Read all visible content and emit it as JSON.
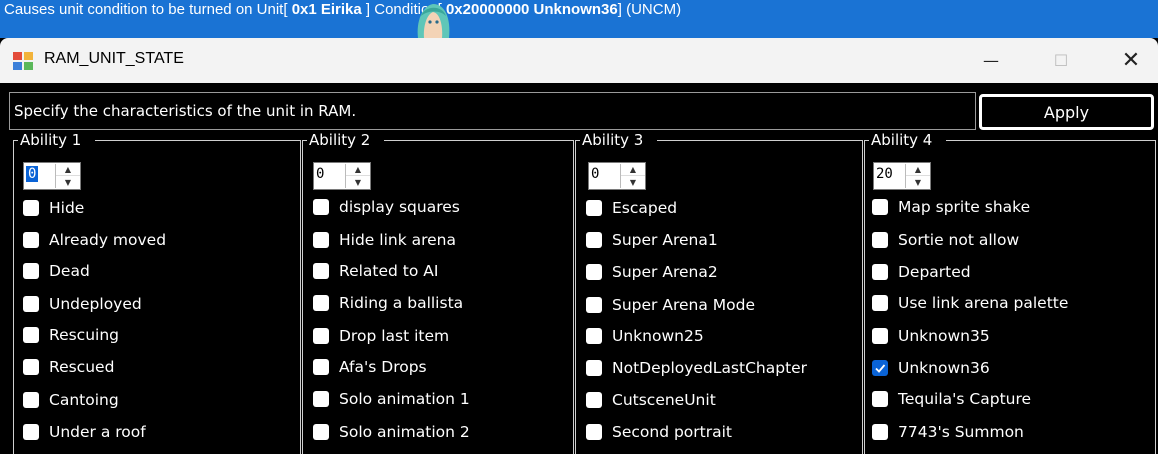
{
  "banner": {
    "prefix": "Causes unit condition to be turned on  Unit[ ",
    "unit_value": "0x1 Eirika",
    "middle": " ] Condition[ ",
    "condition_value": "0x20000000 Unknown36",
    "suffix": "] (UNCM)"
  },
  "window": {
    "title": "RAM_UNIT_STATE",
    "minimize": "—",
    "maximize": "☐",
    "close": "✕"
  },
  "description": "Specify the characteristics of the unit in RAM.",
  "apply_label": "Apply",
  "colors": {
    "banner": "#1a73d4",
    "accent": "#0a63d6"
  },
  "groups": [
    {
      "legend": "Ability 1",
      "spin_value": "0",
      "items": [
        {
          "label": "Hide",
          "checked": false
        },
        {
          "label": "Already moved",
          "checked": false
        },
        {
          "label": "Dead",
          "checked": false
        },
        {
          "label": "Undeployed",
          "checked": false
        },
        {
          "label": "Rescuing",
          "checked": false
        },
        {
          "label": "Rescued",
          "checked": false
        },
        {
          "label": "Cantoing",
          "checked": false
        },
        {
          "label": "Under a roof",
          "checked": false
        }
      ]
    },
    {
      "legend": "Ability 2",
      "spin_value": "0",
      "items": [
        {
          "label": "display squares",
          "checked": false
        },
        {
          "label": "Hide link arena",
          "checked": false
        },
        {
          "label": "Related to AI",
          "checked": false
        },
        {
          "label": "Riding a ballista",
          "checked": false
        },
        {
          "label": "Drop last item",
          "checked": false
        },
        {
          "label": "Afa's Drops",
          "checked": false
        },
        {
          "label": "Solo animation 1",
          "checked": false
        },
        {
          "label": "Solo animation 2",
          "checked": false
        }
      ]
    },
    {
      "legend": "Ability 3",
      "spin_value": "0",
      "items": [
        {
          "label": "Escaped",
          "checked": false
        },
        {
          "label": "Super Arena1",
          "checked": false
        },
        {
          "label": "Super Arena2",
          "checked": false
        },
        {
          "label": "Super Arena Mode",
          "checked": false
        },
        {
          "label": "Unknown25",
          "checked": false
        },
        {
          "label": "NotDeployedLastChapter",
          "checked": false
        },
        {
          "label": "CutsceneUnit",
          "checked": false
        },
        {
          "label": "Second portrait",
          "checked": false
        }
      ]
    },
    {
      "legend": "Ability 4",
      "spin_value": "20",
      "items": [
        {
          "label": "Map sprite shake",
          "checked": false
        },
        {
          "label": "Sortie not allow",
          "checked": false
        },
        {
          "label": "Departed",
          "checked": false
        },
        {
          "label": "Use link arena palette",
          "checked": false
        },
        {
          "label": "Unknown35",
          "checked": false
        },
        {
          "label": "Unknown36",
          "checked": true
        },
        {
          "label": "Tequila's Capture",
          "checked": false
        },
        {
          "label": "7743's Summon",
          "checked": false
        }
      ]
    }
  ]
}
